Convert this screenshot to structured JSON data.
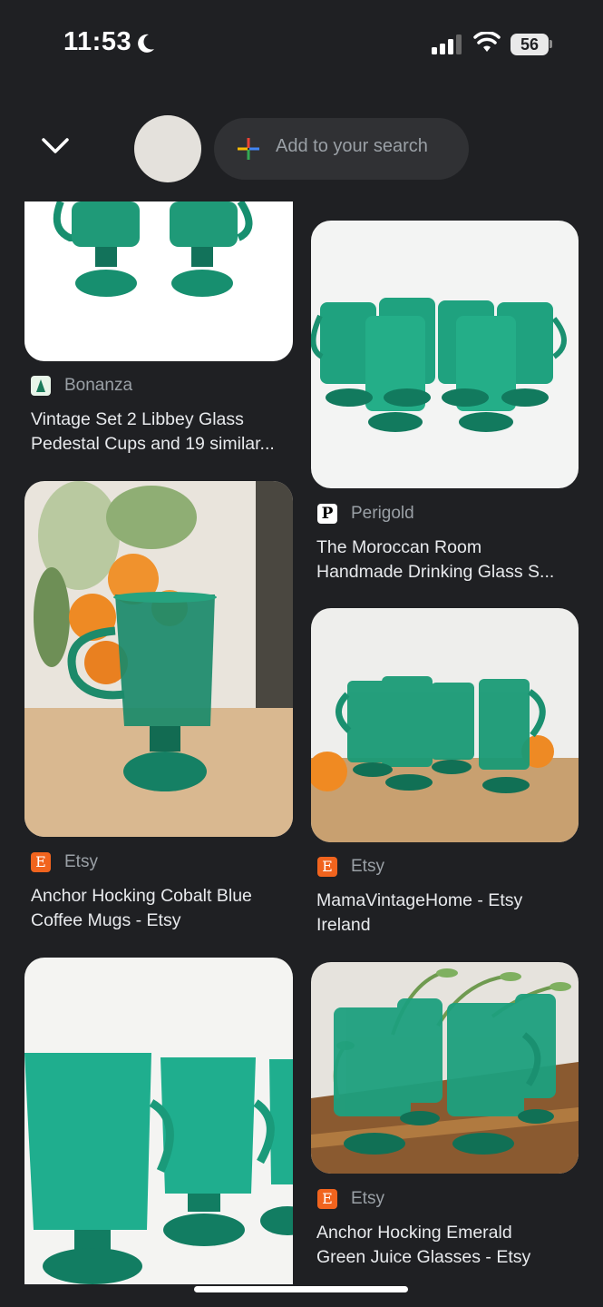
{
  "status_bar": {
    "time": "11:53",
    "battery": "56"
  },
  "search": {
    "placeholder": "Add to your search"
  },
  "results": [
    {
      "source": "Bonanza",
      "title_line1": "Vintage Set 2 Libbey Glass",
      "title_line2": "Pedestal Cups and 19 similar..."
    },
    {
      "source": "Perigold",
      "title_line1": "The Moroccan Room",
      "title_line2": "Handmade Drinking Glass S..."
    },
    {
      "source": "Etsy",
      "title_line1": "Anchor Hocking Cobalt Blue",
      "title_line2": "Coffee Mugs - Etsy"
    },
    {
      "source": "Etsy",
      "title_line1": "MamaVintageHome - Etsy",
      "title_line2": "Ireland"
    },
    {
      "source": "Etsy",
      "title_line1": "Anchor Hocking Emerald",
      "title_line2": "Green Juice Glasses - Etsy"
    }
  ],
  "source_icons": {
    "bonanza": "B",
    "perigold": "P",
    "etsy": "E"
  },
  "colors": {
    "background": "#1f2023",
    "glass_green": "#1a8f6e",
    "etsy_orange": "#f1641e"
  }
}
